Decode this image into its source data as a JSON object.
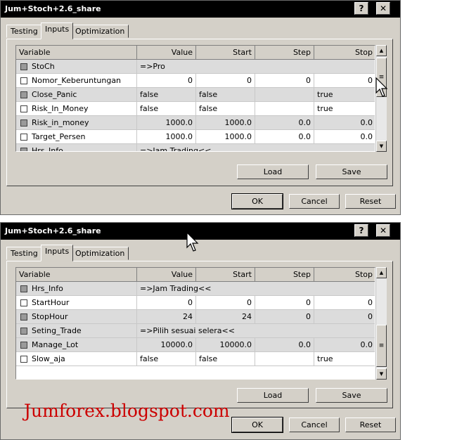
{
  "dialog1": {
    "title": "Jum+Stoch+2.6_share",
    "help_glyph": "?",
    "close_glyph": "✕",
    "tabs": [
      "Testing",
      "Inputs",
      "Optimization"
    ],
    "active_tab": 1,
    "columns": [
      "Variable",
      "Value",
      "Start",
      "Step",
      "Stop"
    ],
    "rows": [
      {
        "name": "StoCh",
        "span": "=>Pro",
        "grey": true
      },
      {
        "name": "Nomor_Keberuntungan",
        "value": "0",
        "start": "0",
        "step": "0",
        "stop": "0",
        "grey": false
      },
      {
        "name": "Close_Panic",
        "value": "false",
        "start": "false",
        "step": "",
        "stop": "true",
        "grey": true
      },
      {
        "name": "Risk_In_Money",
        "value": "false",
        "start": "false",
        "step": "",
        "stop": "true",
        "grey": false
      },
      {
        "name": "Risk_in_money",
        "value": "1000.0",
        "start": "1000.0",
        "step": "0.0",
        "stop": "0.0",
        "grey": true
      },
      {
        "name": "Target_Persen",
        "value": "1000.0",
        "start": "1000.0",
        "step": "0.0",
        "stop": "0.0",
        "grey": false
      },
      {
        "name": "Hrs_Info",
        "span": "=>Jam Trading<<",
        "grey": true
      }
    ],
    "load_label": "Load",
    "save_label": "Save",
    "ok_label": "OK",
    "cancel_label": "Cancel",
    "reset_label": "Reset",
    "scroll_position": 0.15
  },
  "dialog2": {
    "title": "Jum+Stoch+2.6_share",
    "help_glyph": "?",
    "close_glyph": "✕",
    "tabs": [
      "Testing",
      "Inputs",
      "Optimization"
    ],
    "active_tab": 1,
    "columns": [
      "Variable",
      "Value",
      "Start",
      "Step",
      "Stop"
    ],
    "rows": [
      {
        "name": "Hrs_Info",
        "span": "=>Jam Trading<<",
        "grey": true
      },
      {
        "name": "StartHour",
        "value": "0",
        "start": "0",
        "step": "0",
        "stop": "0",
        "grey": false
      },
      {
        "name": "StopHour",
        "value": "24",
        "start": "24",
        "step": "0",
        "stop": "0",
        "grey": true
      },
      {
        "name": "Seting_Trade",
        "span": "=>Pilih sesuai selera<<",
        "grey": true
      },
      {
        "name": "Manage_Lot",
        "value": "10000.0",
        "start": "10000.0",
        "step": "0.0",
        "stop": "0.0",
        "grey": true
      },
      {
        "name": "Slow_aja",
        "value": "false",
        "start": "false",
        "step": "",
        "stop": "true",
        "grey": false
      }
    ],
    "load_label": "Load",
    "save_label": "Save",
    "ok_label": "OK",
    "cancel_label": "Cancel",
    "reset_label": "Reset",
    "scroll_position": 1.0
  },
  "watermark": "Jumforex.blogspot.com"
}
